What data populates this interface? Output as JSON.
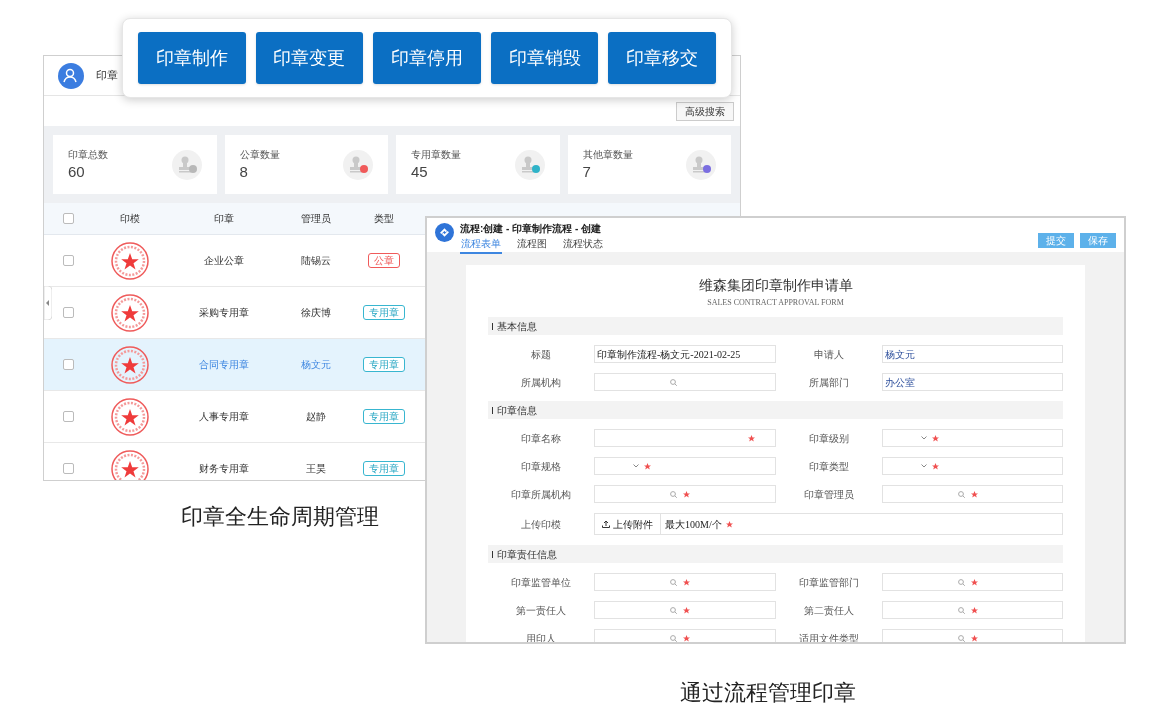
{
  "action_buttons": [
    "印章制作",
    "印章变更",
    "印章停用",
    "印章销毁",
    "印章移交"
  ],
  "seal_manager": {
    "title": "印章",
    "search_button": "高级搜索",
    "stats": [
      {
        "label": "印章总数",
        "value": "60",
        "color": "#b8b8b8"
      },
      {
        "label": "公章数量",
        "value": "8",
        "color": "#f05a5a"
      },
      {
        "label": "专用章数量",
        "value": "45",
        "color": "#2fb3c8"
      },
      {
        "label": "其他章数量",
        "value": "7",
        "color": "#7b6ee0"
      }
    ],
    "table": {
      "select_all_checked": false,
      "columns": [
        "印模",
        "印章",
        "管理员",
        "类型"
      ],
      "rows": [
        {
          "seal": "企业公章",
          "manager": "陆锡云",
          "type": "公章",
          "kind": "public",
          "selected": false,
          "checked": false
        },
        {
          "seal": "采购专用章",
          "manager": "徐庆博",
          "type": "专用章",
          "kind": "special",
          "selected": false,
          "checked": false
        },
        {
          "seal": "合同专用章",
          "manager": "杨文元",
          "type": "专用章",
          "kind": "special",
          "selected": true,
          "checked": false
        },
        {
          "seal": "人事专用章",
          "manager": "赵静",
          "type": "专用章",
          "kind": "special",
          "selected": false,
          "checked": false
        },
        {
          "seal": "财务专用章",
          "manager": "王昊",
          "type": "专用章",
          "kind": "special",
          "selected": false,
          "checked": false
        }
      ]
    }
  },
  "caption_left": "印章全生命周期管理",
  "workflow": {
    "title": "流程:创建 - 印章制作流程 - 创建",
    "tabs": [
      {
        "label": "流程表单",
        "selected": true
      },
      {
        "label": "流程图",
        "selected": false
      },
      {
        "label": "流程状态",
        "selected": false
      }
    ],
    "buttons": [
      "提交",
      "保存"
    ],
    "form": {
      "title": "维森集团印章制作申请单",
      "subtitle": "SALES CONTRACT APPROVAL FORM",
      "sections": [
        {
          "title": "基本信息",
          "fields": [
            {
              "label": "标题",
              "kind": "text",
              "value": "印章制作流程-杨文元-2021-02-25",
              "required": false
            },
            {
              "label": "申请人",
              "kind": "auto",
              "value": "杨文元",
              "required": false
            },
            {
              "label": "所属机构",
              "kind": "search",
              "required": false
            },
            {
              "label": "所属部门",
              "kind": "auto",
              "value": "办公室",
              "required": false
            }
          ]
        },
        {
          "title": "印章信息",
          "fields": [
            {
              "label": "印章名称",
              "kind": "text",
              "required": true
            },
            {
              "label": "印章级别",
              "kind": "select",
              "required": true
            },
            {
              "label": "印章规格",
              "kind": "select",
              "required": true
            },
            {
              "label": "印章类型",
              "kind": "select",
              "required": true
            },
            {
              "label": "印章所属机构",
              "kind": "search",
              "required": true
            },
            {
              "label": "印章管理员",
              "kind": "search",
              "required": true
            },
            {
              "label": "上传印模",
              "kind": "upload",
              "button": "上传附件",
              "hint": "最大100M/个",
              "required": true
            }
          ]
        },
        {
          "title": "印章责任信息",
          "fields": [
            {
              "label": "印章监管单位",
              "kind": "search",
              "required": true
            },
            {
              "label": "印章监管部门",
              "kind": "search",
              "required": true
            },
            {
              "label": "第一责任人",
              "kind": "search",
              "required": true
            },
            {
              "label": "第二责任人",
              "kind": "search",
              "required": true
            },
            {
              "label": "用印人",
              "kind": "search",
              "required": true
            },
            {
              "label": "适用文件类型",
              "kind": "search",
              "required": true
            }
          ]
        }
      ]
    }
  },
  "caption_right": "通过流程管理印章"
}
